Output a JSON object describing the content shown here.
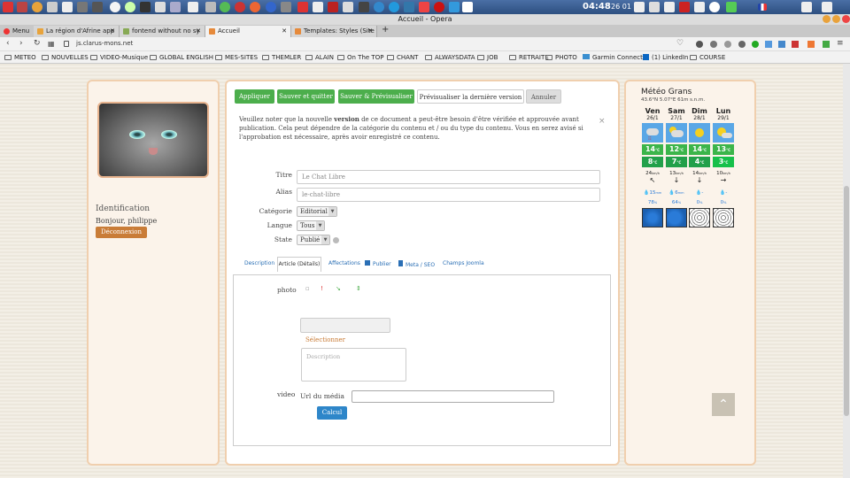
{
  "window": {
    "title": "Accueil - Opera"
  },
  "taskbar": {
    "clock": "04:48",
    "date": "26 01"
  },
  "tabs": [
    {
      "label": "Menu"
    },
    {
      "label": "La région d'Afrine app"
    },
    {
      "label": "fontend without no sy"
    },
    {
      "label": "Accueil"
    },
    {
      "label": "Templates: Styles (Site"
    }
  ],
  "address": {
    "url": "js.clarus-mons.net"
  },
  "bookmarks": [
    "METEO",
    "NOUVELLES",
    "VIDEO-Musique",
    "GLOBAL ENGLISH",
    "MES-SITES",
    "THEMLER",
    "ALAIN",
    "On The TOP",
    "CHANT",
    "ALWAYSDATA",
    "JOB",
    "RETRAITE",
    "PHOTO",
    "Garmin Connect",
    "(1) LinkedIn",
    "COURSE"
  ],
  "user": {
    "heading": "Identification",
    "greeting": "Bonjour, philippe",
    "logout": "Déconnexion"
  },
  "toolbar": {
    "apply": "Appliquer",
    "save_close": "Sauver et quitter",
    "save_preview": "Sauver & Prévisualiser",
    "preview_last": "Prévisualiser la dernière version",
    "cancel": "Annuler"
  },
  "notice": {
    "before": "Veuillez noter que la nouvelle ",
    "bold": "version",
    "after": " de ce document a peut-être besoin d'être vérifiée et approuvée avant publication. Cela peut dépendre de la catégorie du contenu et / ou du type du contenu. Vous en serez avisé si l'approbation est nécessaire, après avoir enregistré ce contenu.",
    "close": "×"
  },
  "form": {
    "title_label": "Titre",
    "title_value": "Le Chat Libre",
    "alias_label": "Alias",
    "alias_value": "le-chat-libre",
    "category_label": "Catégorie",
    "category_value": "Editorial",
    "language_label": "Langue",
    "language_value": "Tous",
    "state_label": "State",
    "state_value": "Publié"
  },
  "subtabs": {
    "description": "Description",
    "article": "Article (Détails)",
    "affectations": "Affectations",
    "publish": "Publier",
    "meta": "Meta / SEO",
    "joomla": "Champs Joomla"
  },
  "details": {
    "photo_label": "photo",
    "select": "Sélectionner",
    "desc_placeholder": "Description",
    "video_label": "video",
    "url_label": "Url du média",
    "calc": "Calcul"
  },
  "meteo": {
    "title": "Météo Grans",
    "subtitle": "43.6°N 5.07°E 61m s.n.m.",
    "days": [
      {
        "day": "Ven",
        "date": "26/1",
        "tmax": "14",
        "tmin": "8",
        "wind": "24",
        "rain": "15",
        "hum": "78",
        "arrow": "↖"
      },
      {
        "day": "Sam",
        "date": "27/1",
        "tmax": "12",
        "tmin": "7",
        "wind": "13",
        "rain": "6",
        "hum": "64",
        "arrow": "↓"
      },
      {
        "day": "Dim",
        "date": "28/1",
        "tmax": "14",
        "tmin": "4",
        "wind": "14",
        "rain": "-",
        "hum": "0",
        "arrow": "↓"
      },
      {
        "day": "Lun",
        "date": "29/1",
        "tmax": "13",
        "tmin": "3",
        "wind": "10",
        "rain": "-",
        "hum": "0",
        "arrow": "→"
      }
    ],
    "unit_c": "°C",
    "unit_wind": "km/h",
    "unit_rain": "mm",
    "unit_hum": "%"
  },
  "colors": {
    "green_button": "#4cae4c",
    "accent_orange": "#c97c37",
    "calc_blue": "#2e86c9",
    "panel_border": "#f0cfae"
  }
}
